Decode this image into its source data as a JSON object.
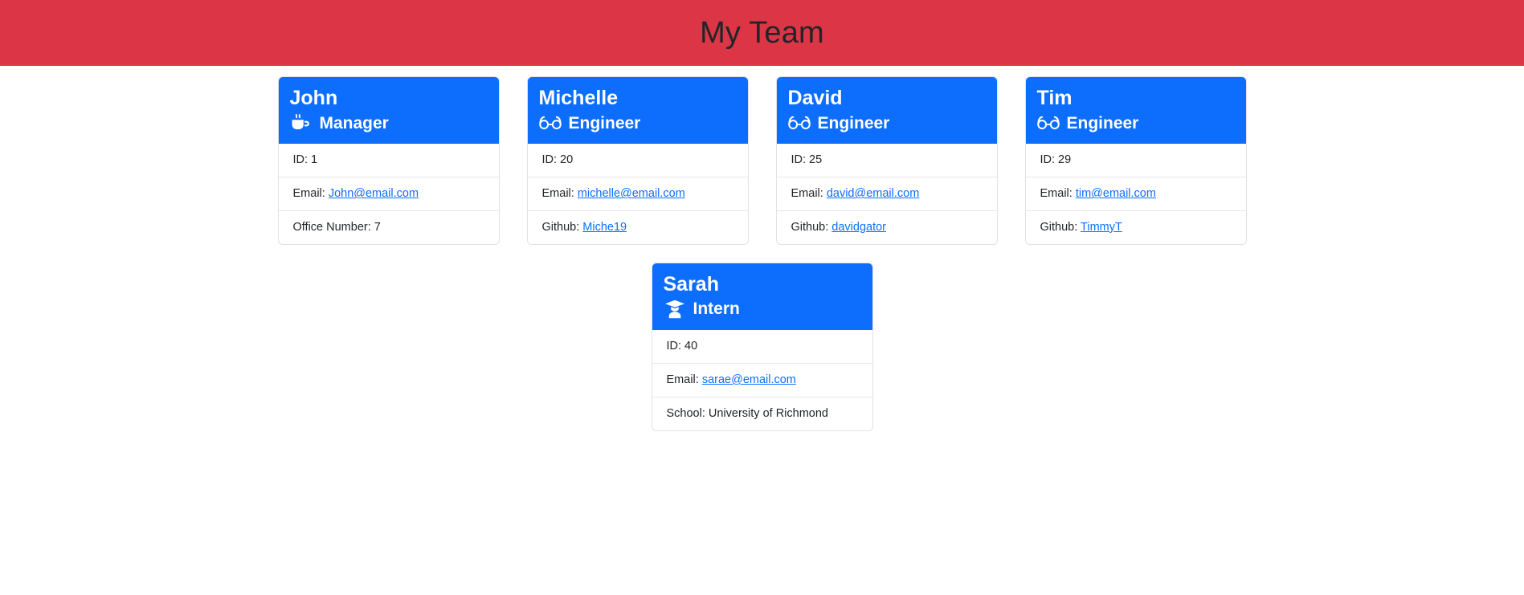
{
  "header": {
    "title": "My Team",
    "background_color": "#dc3545",
    "title_color": "#212529"
  },
  "theme": {
    "card_header_color": "#0d6efd",
    "card_border_color": "#dee2e6",
    "link_color": "#0d6efd",
    "page_background": "#ffffff"
  },
  "labels": {
    "id_prefix": "ID: ",
    "email_prefix": "Email: ",
    "github_prefix": "Github: ",
    "office_prefix": "Office Number: ",
    "school_prefix": "School: "
  },
  "cards": [
    {
      "name": "John",
      "role": "Manager",
      "role_icon": "coffee-mug-icon",
      "id_text": "ID: 1",
      "email_label": "Email: ",
      "email": "John@email.com",
      "extra_label": "Office Number: ",
      "extra_value": "7",
      "extra_is_link": false
    },
    {
      "name": "Michelle",
      "role": "Engineer",
      "role_icon": "glasses-icon",
      "id_text": "ID: 20",
      "email_label": "Email: ",
      "email": "michelle@email.com",
      "extra_label": "Github: ",
      "extra_value": "Miche19",
      "extra_is_link": true
    },
    {
      "name": "David",
      "role": "Engineer",
      "role_icon": "glasses-icon",
      "id_text": "ID: 25",
      "email_label": "Email: ",
      "email": "david@email.com",
      "extra_label": "Github: ",
      "extra_value": "davidgator",
      "extra_is_link": true
    },
    {
      "name": "Tim",
      "role": "Engineer",
      "role_icon": "glasses-icon",
      "id_text": "ID: 29",
      "email_label": "Email: ",
      "email": "tim@email.com",
      "extra_label": "Github: ",
      "extra_value": "TimmyT",
      "extra_is_link": true
    },
    {
      "name": "Sarah",
      "role": "Intern",
      "role_icon": "user-graduate-icon",
      "id_text": "ID: 40",
      "email_label": "Email: ",
      "email": "sarae@email.com",
      "extra_label": "School: ",
      "extra_value": "University of Richmond",
      "extra_is_link": false
    }
  ]
}
